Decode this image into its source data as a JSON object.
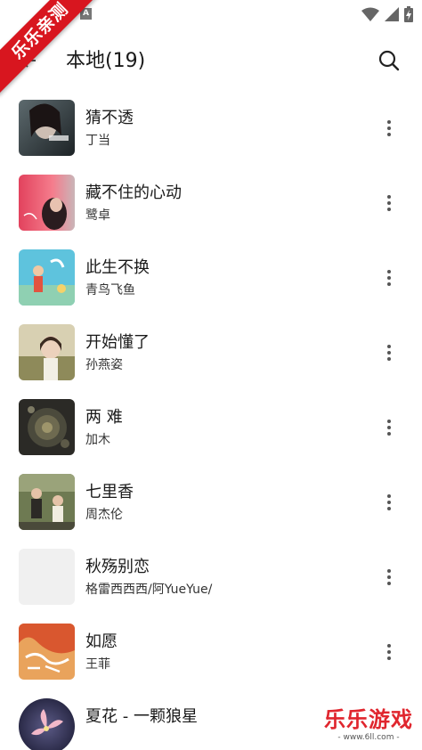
{
  "status_bar": {
    "notification_letter": "A",
    "icons": [
      "wifi-icon",
      "cell-signal-icon",
      "battery-charging-icon"
    ]
  },
  "watermark_ribbon": "乐乐亲测",
  "header": {
    "title": "本地(19)",
    "back_icon": "back-arrow-icon",
    "search_icon": "search-icon"
  },
  "songs": [
    {
      "title": "猜不透",
      "artist": "丁当"
    },
    {
      "title": "藏不住的心动",
      "artist": "鹭卓"
    },
    {
      "title": "此生不换",
      "artist": "青鸟飞鱼"
    },
    {
      "title": "开始懂了",
      "artist": "孙燕姿"
    },
    {
      "title": "两 难",
      "artist": "加木"
    },
    {
      "title": "七里香",
      "artist": "周杰伦"
    },
    {
      "title": "秋殇别恋",
      "artist": "格雷西西西/阿YueYue/"
    },
    {
      "title": "如愿",
      "artist": "王菲"
    },
    {
      "title": "夏花 - 一颗狼星",
      "artist": ""
    }
  ],
  "watermark": {
    "text": "乐乐游戏",
    "url": "- www.6ll.com -"
  },
  "colors": {
    "ribbon": "#d8161f",
    "watermark": "#e0262e",
    "icon": "#555555"
  }
}
